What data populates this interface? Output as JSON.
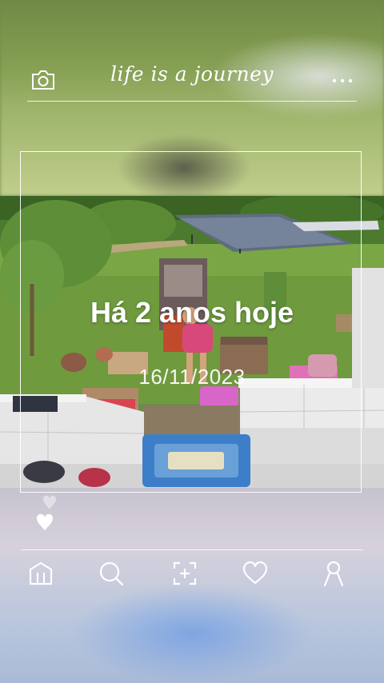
{
  "header": {
    "title": "life is a journey",
    "camera_icon": "camera-icon",
    "more_icon": "more-icon"
  },
  "memory": {
    "title": "Há 2 anos hoje",
    "date": "16/11/2023"
  },
  "nav": {
    "items": [
      {
        "icon": "home-icon"
      },
      {
        "icon": "search-icon"
      },
      {
        "icon": "scan-add-icon"
      },
      {
        "icon": "heart-icon"
      },
      {
        "icon": "profile-icon"
      }
    ]
  },
  "colors": {
    "foreground": "#ffffff",
    "grass": "#6f9a3e",
    "tile": "#e9e9ea"
  }
}
